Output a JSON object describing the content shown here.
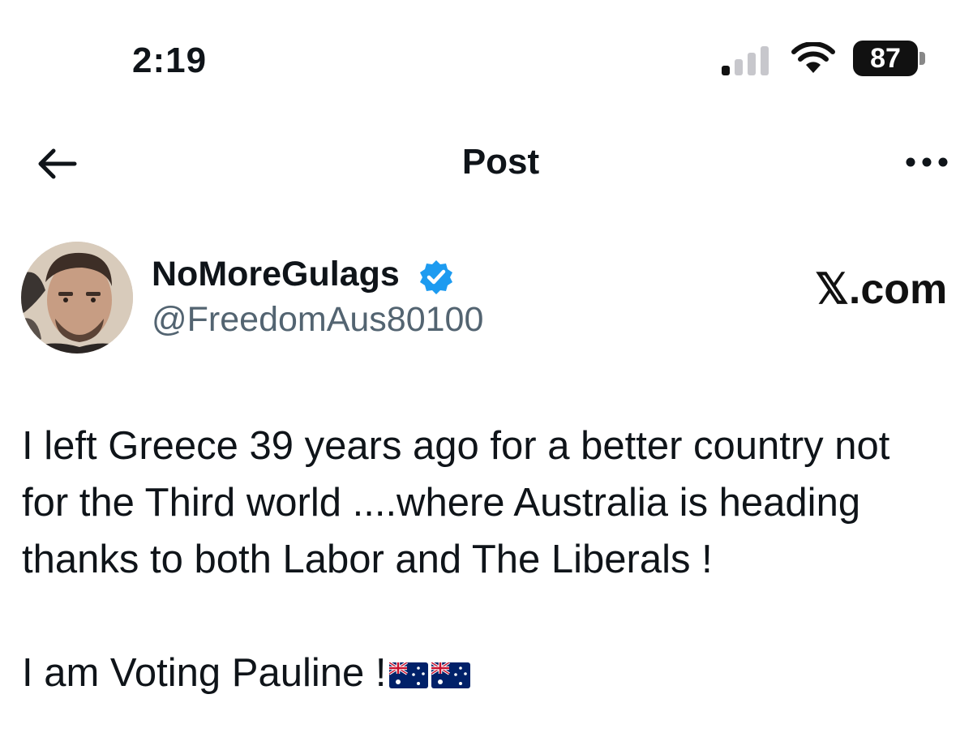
{
  "status_bar": {
    "time": "2:19",
    "battery_level": "87",
    "icons": [
      "cellular-signal-icon",
      "wifi-icon",
      "battery-icon"
    ]
  },
  "nav": {
    "title": "Post",
    "back_icon": "arrow-left-icon",
    "more_icon": "more-horizontal-icon"
  },
  "author": {
    "display_name": "NoMoreGulags",
    "handle": "@FreedomAus80100",
    "verified": true,
    "verified_color": "#1d9bf0"
  },
  "watermark": "𝕏.com",
  "post": {
    "lines": [
      "I left Greece 39 years ago for a better country not",
      "for the Third world ....where Australia is heading",
      "thanks to both Labor and The Liberals !",
      "I am Voting Pauline !"
    ],
    "emoji": [
      "australia-flag-icon",
      "australia-flag-icon"
    ]
  },
  "colors": {
    "text": "#0f1419",
    "secondary_text": "#536471",
    "background": "#ffffff"
  }
}
